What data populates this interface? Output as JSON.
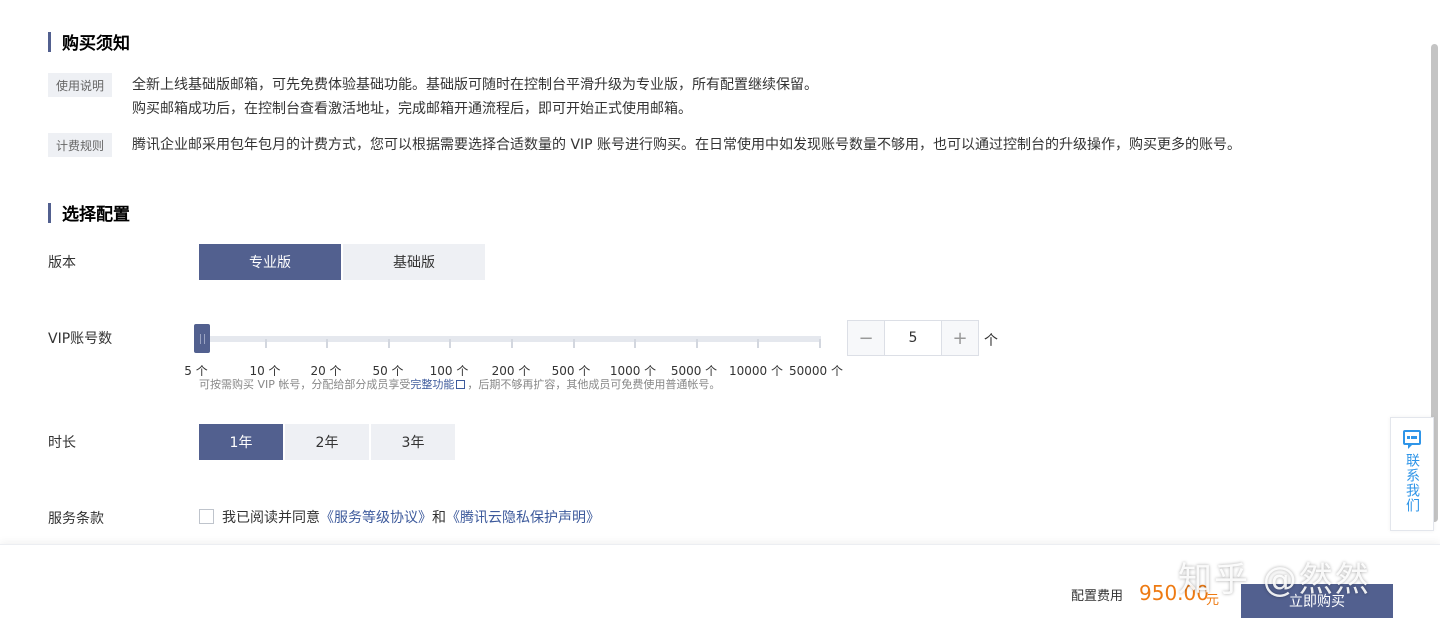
{
  "notice": {
    "title": "购买须知",
    "usage_tag": "使用说明",
    "usage_line1": "全新上线基础版邮箱，可先免费体验基础功能。基础版可随时在控制台平滑升级为专业版，所有配置继续保留。",
    "usage_line2": "购买邮箱成功后，在控制台查看激活地址，完成邮箱开通流程后，即可开始正式使用邮箱。",
    "billing_tag": "计费规则",
    "billing_text": "腾讯企业邮采用包年包月的计费方式，您可以根据需要选择合适数量的 VIP 账号进行购买。在日常使用中如发现账号数量不够用，也可以通过控制台的升级操作，购买更多的账号。"
  },
  "config": {
    "title": "选择配置",
    "edition": {
      "label": "版本",
      "options": [
        "专业版",
        "基础版"
      ],
      "selected": "专业版"
    },
    "vip": {
      "label": "VIP账号数",
      "ticks": [
        "5 个",
        "10 个",
        "20 个",
        "50 个",
        "100 个",
        "200 个",
        "500 个",
        "1000 个",
        "5000 个",
        "10000 个",
        "50000 个"
      ],
      "hint_before": "可按需购买 VIP 帐号，分配给部分成员享受",
      "hint_link": "完整功能",
      "hint_after": "，后期不够再扩容，其他成员可免费使用普通帐号。",
      "stepper_minus": "−",
      "stepper_value": "5",
      "stepper_plus": "+",
      "unit": "个"
    },
    "duration": {
      "label": "时长",
      "options": [
        "1年",
        "2年",
        "3年"
      ],
      "selected": "1年"
    },
    "terms": {
      "label": "服务条款",
      "prefix": "我已阅读并同意",
      "link1": "《服务等级协议》",
      "middle": "和",
      "link2": "《腾讯云隐私保护声明》",
      "checked": false
    }
  },
  "contact": {
    "label": "联系我们",
    "icon": "chat-icon"
  },
  "footer": {
    "fee_label": "配置费用",
    "fee_amount": "950.00",
    "fee_unit": "元",
    "buy_label": "立即购买"
  },
  "watermark": "知乎 @然然",
  "colors": {
    "accent": "#52608f",
    "price": "#ee7a12",
    "link": "#3d5a9c",
    "contact": "#2f95e8"
  }
}
